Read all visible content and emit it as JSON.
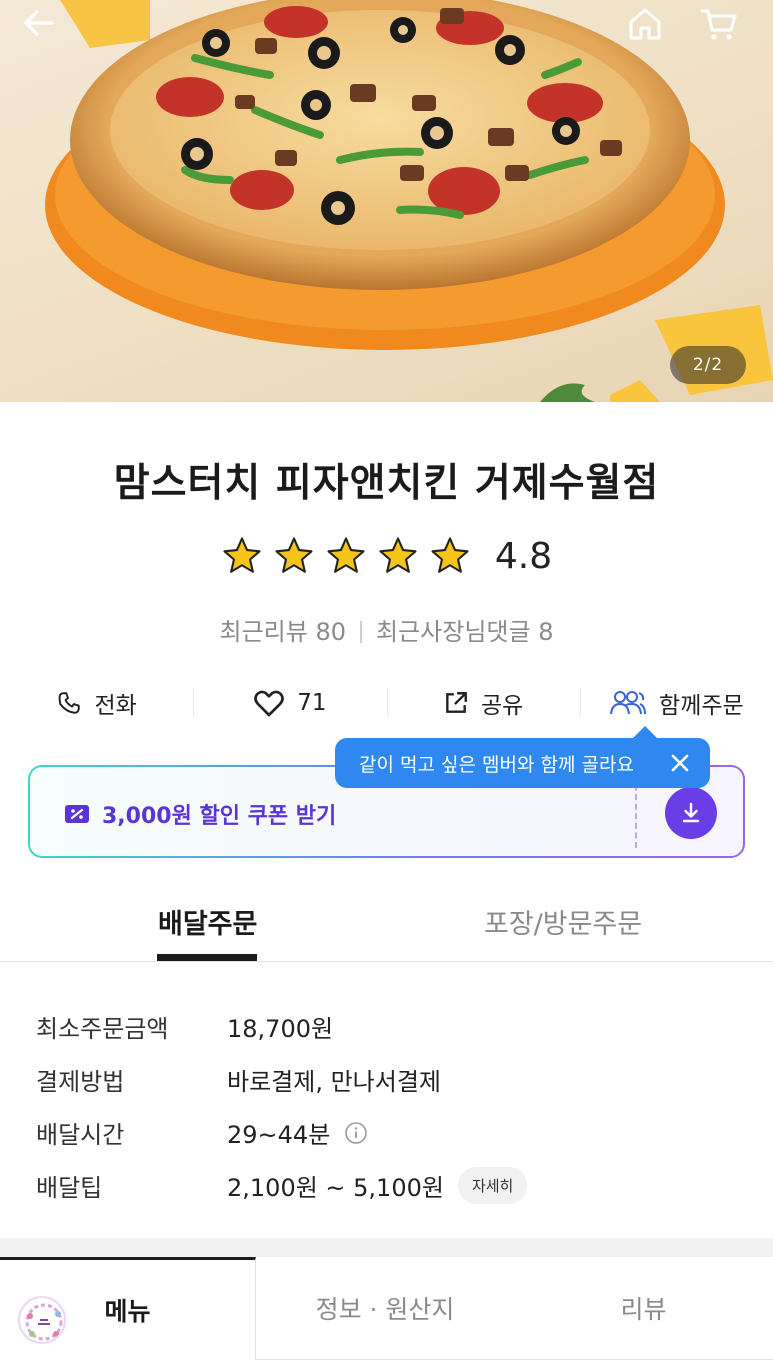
{
  "hero": {
    "pager": "2/2"
  },
  "store": {
    "name": "맘스터치 피자앤치킨 거제수월점",
    "rating": "4.8",
    "stars": 5,
    "recent_reviews": "최근리뷰 80",
    "owner_comments": "최근사장님댓글 8"
  },
  "actions": {
    "call": "전화",
    "likes": "71",
    "share": "공유",
    "group_order": "함께주문"
  },
  "tooltip": {
    "text": "같이 먹고 싶은 멤버와 함께 골라요"
  },
  "coupon": {
    "label": "3,000원 할인 쿠폰 받기"
  },
  "order_tabs": {
    "delivery": "배달주문",
    "pickup": "포장/방문주문"
  },
  "info": {
    "rows": [
      {
        "label": "최소주문금액",
        "value": "18,700원"
      },
      {
        "label": "결제방법",
        "value": "바로결제, 만나서결제"
      },
      {
        "label": "배달시간",
        "value": "29~44분"
      },
      {
        "label": "배달팁",
        "value": "2,100원 ~ 5,100원"
      }
    ],
    "detail_button": "자세히"
  },
  "menu_tabs": {
    "menu": "메뉴",
    "info": "정보 · 원산지",
    "review": "리뷰"
  },
  "colors": {
    "accent_purple": "#6a3ee6",
    "tooltip_blue": "#2f88f0",
    "star_yellow": "#f5c518"
  }
}
